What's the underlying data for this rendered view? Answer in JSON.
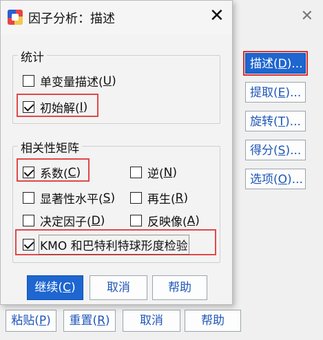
{
  "dialog": {
    "title": "因子分析：描述",
    "close_glyph": "✕"
  },
  "background": {
    "close_glyph": "✕",
    "side_buttons": [
      {
        "label": "描述(",
        "key": "D",
        "suffix": ")..."
      },
      {
        "label": "提取(",
        "key": "E",
        "suffix": ")..."
      },
      {
        "label": "旋转(",
        "key": "T",
        "suffix": ")..."
      },
      {
        "label": "得分(",
        "key": "S",
        "suffix": ")..."
      },
      {
        "label": "选项(",
        "key": "O",
        "suffix": ")..."
      }
    ],
    "bottom_buttons": [
      {
        "label": "粘贴(",
        "key": "P",
        "suffix": ")"
      },
      {
        "label": "重置(",
        "key": "R",
        "suffix": ")"
      },
      {
        "label": "取消",
        "key": "",
        "suffix": ""
      },
      {
        "label": "帮助",
        "key": "",
        "suffix": ""
      }
    ]
  },
  "statistics": {
    "label": "统计",
    "univariate": {
      "label": "单变量描述(",
      "key": "U",
      "suffix": ")",
      "checked": false
    },
    "initial": {
      "label": "初始解(",
      "key": "I",
      "suffix": ")",
      "checked": true
    }
  },
  "correlation": {
    "label": "相关性矩阵",
    "coefficients": {
      "label": "系数(",
      "key": "C",
      "suffix": ")",
      "checked": true
    },
    "inverse": {
      "label": "逆(",
      "key": "N",
      "suffix": ")",
      "checked": false
    },
    "significance": {
      "label": "显著性水平(",
      "key": "S",
      "suffix": ")",
      "checked": false
    },
    "reproduced": {
      "label": "再生(",
      "key": "R",
      "suffix": ")",
      "checked": false
    },
    "determinant": {
      "label": "决定因子(",
      "key": "D",
      "suffix": ")",
      "checked": false
    },
    "anti_image": {
      "label": "反映像(",
      "key": "A",
      "suffix": ")",
      "checked": false
    },
    "kmo": {
      "label": "KMO 和巴特利特球形度检验",
      "checked": true
    }
  },
  "buttons": {
    "continue": {
      "label": "继续(",
      "key": "C",
      "suffix": ")"
    },
    "cancel": "取消",
    "help": "帮助"
  },
  "colors": {
    "accent": "#1e66d0",
    "link_text": "#1f57b8",
    "highlight_red": "#e04848"
  }
}
